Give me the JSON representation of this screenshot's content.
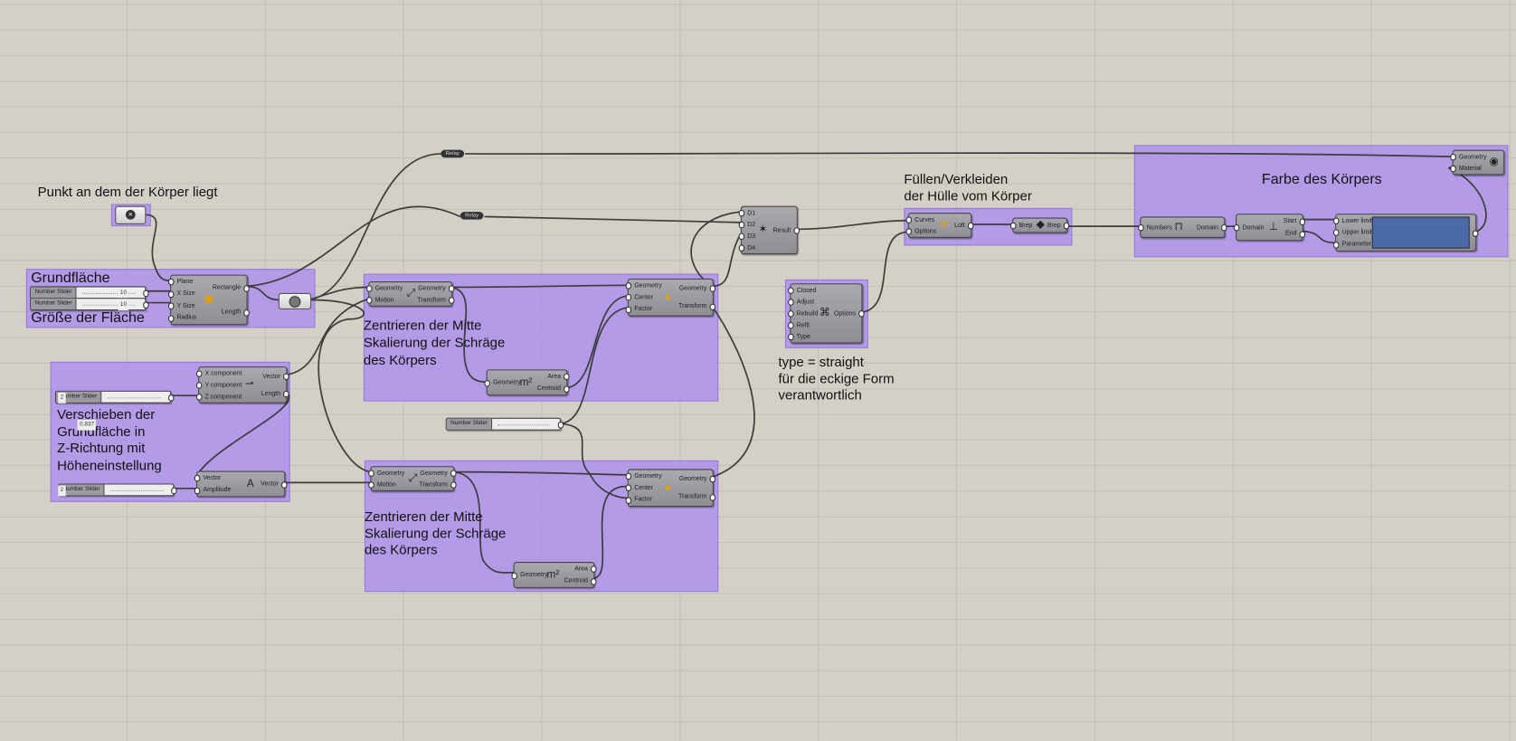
{
  "canvas": {
    "background": "#d4d0c8",
    "group_color": "#b39cec"
  },
  "notes": {
    "punkt": "Punkt an dem der Körper liegt",
    "grundflaeche": "Grundfläche",
    "groesse": "Größe der Fläche",
    "zentrieren1": "Zentrieren der Mitte\nSkalierung der Schräge\ndes Körpers",
    "zentrieren2": "Zentrieren der Mitte\nSkalierung der Schräge\ndes Körpers",
    "verschieben": "Verschieben der\nGrundfläche in\nZ-Richtung mit\nHöheneinstellung",
    "type": "type = straight\nfür die eckige Form\nverantwortlich",
    "fuellen": "Füllen/Verkleiden\nder Hülle vom Körper",
    "farbe": "Farbe des Körpers"
  },
  "sliders": [
    {
      "id": "s_x",
      "label": "Number Slider",
      "value": "10"
    },
    {
      "id": "s_y",
      "label": "Number Slider",
      "value": "10"
    },
    {
      "id": "s_z",
      "label": "Number Slider",
      "value": "2"
    },
    {
      "id": "s_amp",
      "label": "Number Slider",
      "value": "2"
    },
    {
      "id": "s_factor",
      "label": "Number Slider",
      "value": "0.837"
    }
  ],
  "relays": [
    {
      "id": "r1",
      "label": "Relay"
    },
    {
      "id": "r2",
      "label": "Relay"
    }
  ],
  "components": [
    {
      "id": "rect",
      "name": "rectangle-component",
      "inputs": [
        "Plane",
        "X Size",
        "Y Size",
        "Radius"
      ],
      "outputs": [
        "Rectangle",
        "Length"
      ],
      "icon": "rectangle-icon",
      "glyph": "▣"
    },
    {
      "id": "move1",
      "name": "move-component",
      "inputs": [
        "Geometry",
        "Motion"
      ],
      "outputs": [
        "Geometry",
        "Transform"
      ],
      "icon": "move-icon",
      "glyph": "⤢"
    },
    {
      "id": "scale1",
      "name": "scale-component",
      "inputs": [
        "Geometry",
        "Center",
        "Factor"
      ],
      "outputs": [
        "Geometry",
        "Transform"
      ],
      "icon": "scale-icon",
      "glyph": "●"
    },
    {
      "id": "area1",
      "name": "area-component",
      "inputs": [
        "Geometry"
      ],
      "outputs": [
        "Area",
        "Centroid"
      ],
      "icon": "area-icon",
      "glyph": "m²"
    },
    {
      "id": "vec",
      "name": "vector-xyz-component",
      "inputs": [
        "X component",
        "Y component",
        "Z component"
      ],
      "outputs": [
        "Vector",
        "Length"
      ],
      "icon": "vector-xyz-icon",
      "glyph": "⇀"
    },
    {
      "id": "amp",
      "name": "amplitude-component",
      "inputs": [
        "Vector",
        "Amplitude"
      ],
      "outputs": [
        "Vector"
      ],
      "icon": "amplitude-icon",
      "glyph": "A"
    },
    {
      "id": "move2",
      "name": "move-component",
      "inputs": [
        "Geometry",
        "Motion"
      ],
      "outputs": [
        "Geometry",
        "Transform"
      ],
      "icon": "move-icon",
      "glyph": "⤢"
    },
    {
      "id": "scale2",
      "name": "scale-component",
      "inputs": [
        "Geometry",
        "Center",
        "Factor"
      ],
      "outputs": [
        "Geometry",
        "Transform"
      ],
      "icon": "scale-icon",
      "glyph": "●"
    },
    {
      "id": "area2",
      "name": "area-component",
      "inputs": [
        "Geometry"
      ],
      "outputs": [
        "Area",
        "Centroid"
      ],
      "icon": "area-icon",
      "glyph": "m²"
    },
    {
      "id": "merge",
      "name": "merge-component",
      "inputs": [
        "D1",
        "D2",
        "D3",
        "D4"
      ],
      "outputs": [
        "Result"
      ],
      "icon": "merge-icon",
      "glyph": "✶"
    },
    {
      "id": "opts",
      "name": "loft-options-component",
      "inputs": [
        "Closed",
        "Adjust",
        "Rebuild",
        "Refit",
        "Type"
      ],
      "outputs": [
        "Options"
      ],
      "icon": "loft-options-icon",
      "glyph": "⌘"
    },
    {
      "id": "loft",
      "name": "loft-component",
      "inputs": [
        "Curves",
        "Options"
      ],
      "outputs": [
        "Loft"
      ],
      "icon": "loft-icon",
      "glyph": "≋"
    },
    {
      "id": "brep",
      "name": "brep-param",
      "inputs": [
        "Brep"
      ],
      "outputs": [
        "Brep"
      ],
      "icon": "brep-icon",
      "glyph": "◆"
    },
    {
      "id": "bounds",
      "name": "bounds-component",
      "inputs": [
        "Numbers"
      ],
      "outputs": [
        "Domain"
      ],
      "icon": "bounds-icon",
      "glyph": "⊓"
    },
    {
      "id": "dedom",
      "name": "deconstruct-domain-component",
      "inputs": [
        "Domain"
      ],
      "outputs": [
        "Start",
        "End"
      ],
      "icon": "deconstruct-domain-icon",
      "glyph": "⊥"
    },
    {
      "id": "grad",
      "name": "gradient-component",
      "inputs": [
        "Lower limit",
        "Upper limit",
        "Parameter"
      ],
      "outputs": [
        ""
      ],
      "icon": "gradient-icon",
      "glyph": ""
    },
    {
      "id": "prev",
      "name": "custom-preview-component",
      "inputs": [
        "Geometry",
        "Material"
      ],
      "outputs": [],
      "icon": "preview-icon",
      "glyph": "◉"
    }
  ],
  "colors": {
    "gradient_panel": "#4a6aa8",
    "wire": "#3d3d3d"
  }
}
